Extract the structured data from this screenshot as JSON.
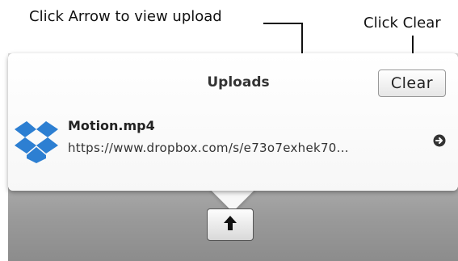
{
  "annotations": {
    "arrow_hint": "Click Arrow to view upload",
    "clear_hint": "Click Clear"
  },
  "popover": {
    "title": "Uploads",
    "clear_label": "Clear",
    "item": {
      "name": "Motion.mp4",
      "url": "https://www.dropbox.com/s/e73o7exhek70..."
    }
  },
  "icons": {
    "file_icon": "dropbox-icon",
    "reveal": "arrow-circle-right-icon",
    "toolbar": "arrow-up-icon"
  },
  "colors": {
    "dropbox_blue": "#2d7fd2",
    "toolbar_gray": "#9a9a9a"
  }
}
